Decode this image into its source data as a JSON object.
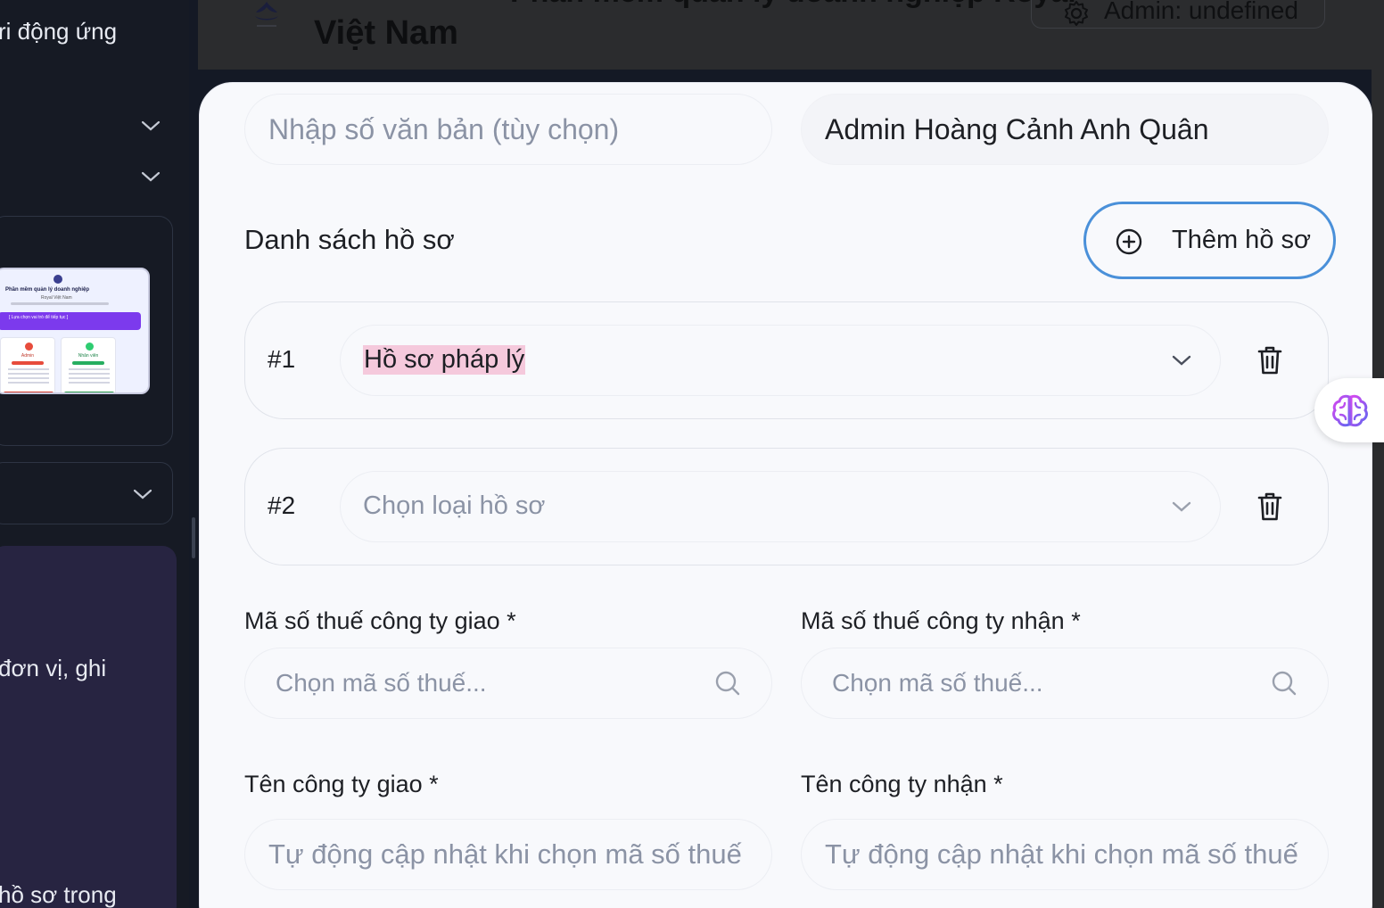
{
  "sidebar": {
    "text_top": "ri động ứng",
    "text_mid": "đơn vị, ghi",
    "text_bottom": "hồ sơ trong",
    "thumbnail": {
      "title": "Phần mềm quản lý doanh nghiệp",
      "subtitle": "Royal Việt Nam",
      "banner": "[ Lựa chọn vai trò để tiếp tục ]",
      "card_admin": "Admin",
      "card_staff": "Nhân viên"
    }
  },
  "header": {
    "title_partial": "Phần mềm quản lý doanh nghiệp Royal",
    "title_line2": "Việt Nam",
    "admin_label": "Admin: undefined"
  },
  "modal": {
    "doc_number_placeholder": "Nhập số văn bản (tùy chọn)",
    "admin_name": "Admin Hoàng Cảnh Anh Quân",
    "list_title": "Danh sách hồ sơ",
    "add_button": "Thêm hồ sơ",
    "records": [
      {
        "index": "#1",
        "value": "Hồ sơ pháp lý"
      },
      {
        "index": "#2",
        "placeholder": "Chọn loại hồ sơ"
      }
    ],
    "tax_send_label": "Mã số thuế công ty giao *",
    "tax_receive_label": "Mã số thuế công ty nhận *",
    "tax_placeholder": "Chọn mã số thuế...",
    "company_send_label": "Tên công ty giao *",
    "company_receive_label": "Tên công ty nhận *",
    "company_placeholder": "Tự động cập nhật khi chọn mã số thuế"
  },
  "colors": {
    "accent_blue": "#4a90d9",
    "highlight_pink": "#f5c9dc",
    "placeholder_gray": "#8b93a5"
  },
  "icons": [
    "chevron-down-icon",
    "plus-circle-icon",
    "trash-icon",
    "search-icon",
    "gear-icon",
    "brain-icon"
  ]
}
